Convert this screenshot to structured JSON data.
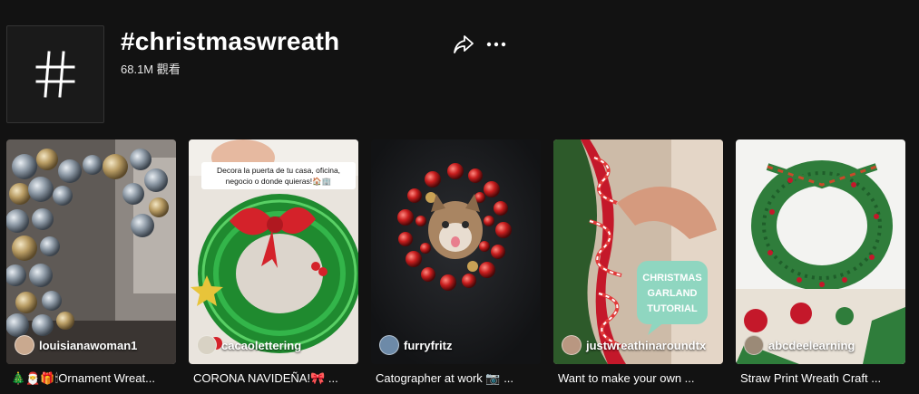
{
  "header": {
    "title": "#christmaswreath",
    "views": "68.1M 觀看",
    "avatar_icon": "hashtag-icon",
    "share_icon": "share-arrow-icon",
    "more_icon": "more-dots-icon"
  },
  "videos": [
    {
      "author": "louisianawoman1",
      "caption": "🎄🎅🎁🕯Ornament Wreat...",
      "avatar_color": "#c9a98f"
    },
    {
      "author": "cacaolettering",
      "caption": "CORONA NAVIDEÑA!🎀 ...",
      "overlay_lines": [
        "Decora la puerta de tu casa, oficina,",
        "negocio o donde quieras!🏠🏢"
      ],
      "avatar_color": "#d8d2c4"
    },
    {
      "author": "furryfritz",
      "caption": "Catographer at work 📷 ...",
      "avatar_color": "#6d8aa8"
    },
    {
      "author": "justwreathinaroundtx",
      "caption": "Want to make your own ...",
      "overlay_lines": [
        "CHRISTMAS",
        "GARLAND",
        "TUTORIAL"
      ],
      "avatar_color": "#b99781"
    },
    {
      "author": "abcdeelearning",
      "caption": "Straw Print Wreath Craft ...",
      "avatar_color": "#9b8a77"
    }
  ]
}
